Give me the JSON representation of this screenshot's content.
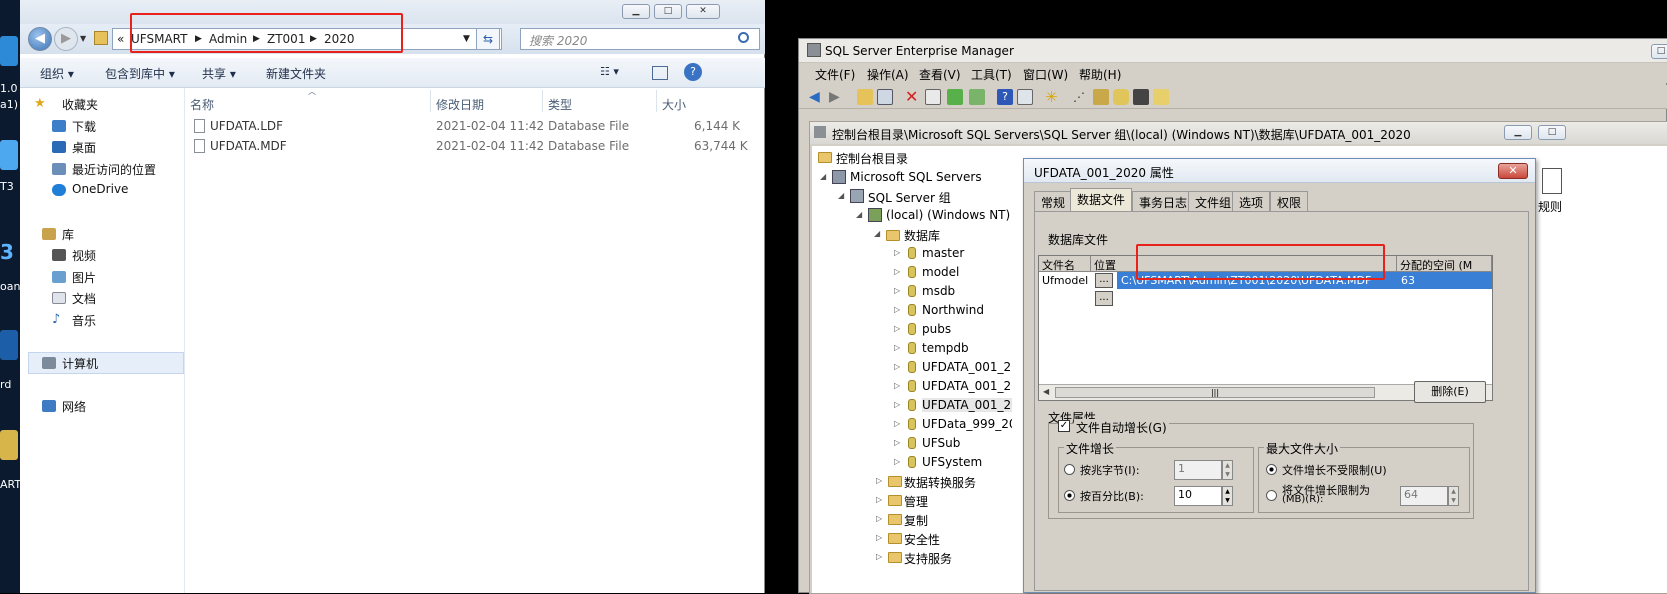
{
  "desktop": {
    "labels": [
      "1.0",
      "a1)",
      "T3",
      "3",
      "oan",
      "rd",
      "ART"
    ]
  },
  "explorer": {
    "breadcrumbs": [
      "«",
      "UFSMART",
      "Admin",
      "ZT001",
      "2020"
    ],
    "search_placeholder": "搜索 2020",
    "toolbar": {
      "organize": "组织 ▾",
      "include": "包含到库中 ▾",
      "share": "共享 ▾",
      "new_folder": "新建文件夹"
    },
    "nav": {
      "favorites": "收藏夹",
      "downloads": "下载",
      "desktop": "桌面",
      "recent": "最近访问的位置",
      "onedrive": "OneDrive",
      "libraries": "库",
      "videos": "视频",
      "pictures": "图片",
      "documents": "文档",
      "music": "音乐",
      "computer": "计算机",
      "network": "网络"
    },
    "columns": {
      "name": "名称",
      "modified": "修改日期",
      "type": "类型",
      "size": "大小"
    },
    "files": [
      {
        "name": "UFDATA.LDF",
        "modified": "2021-02-04 11:42",
        "type": "Database File",
        "size": "6,144 K"
      },
      {
        "name": "UFDATA.MDF",
        "modified": "2021-02-04 11:42",
        "type": "Database File",
        "size": "63,744 K"
      }
    ]
  },
  "em": {
    "title": "SQL Server Enterprise Manager",
    "menu": [
      "文件(F)",
      "操作(A)",
      "查看(V)",
      "工具(T)",
      "窗口(W)",
      "帮助(H)"
    ],
    "child_title": "控制台根目录\\Microsoft SQL Servers\\SQL Server 组\\(local) (Windows NT)\\数据库\\UFDATA_001_2020",
    "tree": {
      "root": "控制台根目录",
      "servers": "Microsoft SQL Servers",
      "group": "SQL Server 组",
      "local": "(local) (Windows NT)",
      "databases": "数据库",
      "dbs": [
        "master",
        "model",
        "msdb",
        "Northwind",
        "pubs",
        "tempdb",
        "UFDATA_001_20",
        "UFDATA_001_20",
        "UFDATA_001_20",
        "UFData_999_20",
        "UFSub",
        "UFSystem"
      ],
      "folders": [
        "数据转换服务",
        "管理",
        "复制",
        "安全性",
        "支持服务"
      ]
    },
    "right_item": "规则"
  },
  "dialog": {
    "title": "UFDATA_001_2020 属性",
    "tabs": [
      "常规",
      "数据文件",
      "事务日志",
      "文件组",
      "选项",
      "权限"
    ],
    "section": "数据库文件",
    "grid_headers": {
      "file_name": "文件名",
      "location": "位置",
      "allocated": "分配的空间 (M"
    },
    "row": {
      "file_name": "Ufmodel",
      "location": "C:\\UFSMART\\Admin\\ZT001\\2020\\UFDATA.MDF",
      "allocated": "63",
      "browse": "..."
    },
    "browse2": "...",
    "delete_button": "删除(E)",
    "props_label": "文件属性",
    "autogrow": "文件自动增长(G)",
    "growth_group": "文件增长",
    "growth_mb": "按兆字节(I):",
    "growth_mb_value": "1",
    "growth_pct": "按百分比(B):",
    "growth_pct_value": "10",
    "max_group": "最大文件大小",
    "unlimited": "文件增长不受限制(U)",
    "limited": "将文件增长限制为",
    "limited2": "(MB)(R):",
    "limited_value": "64"
  }
}
